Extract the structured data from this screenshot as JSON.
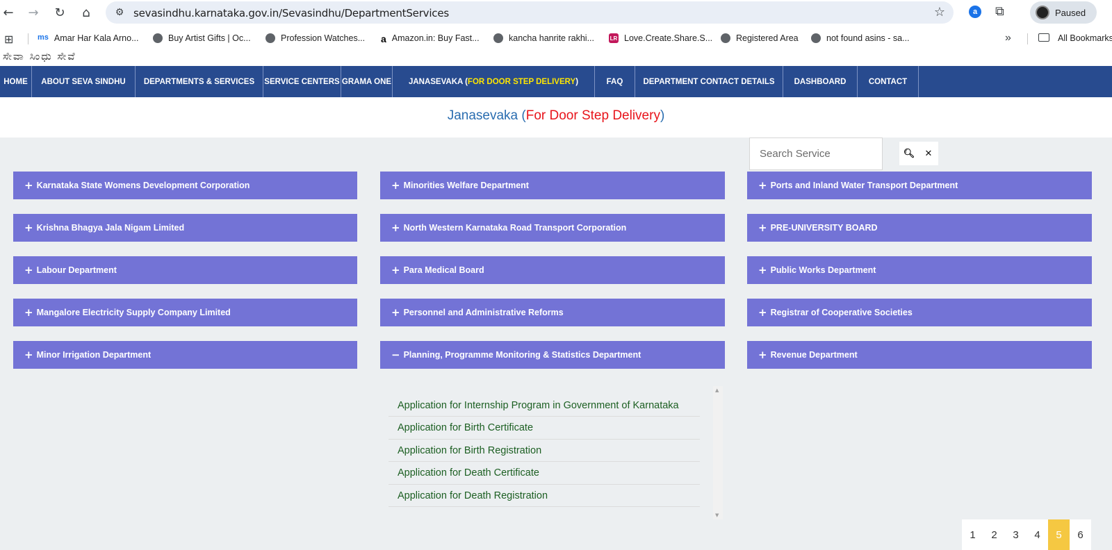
{
  "browser": {
    "url": "sevasindhu.karnataka.gov.in/Sevasindhu/DepartmentServices",
    "profile_label": "Paused",
    "ext_letter": "a",
    "bookmarks": [
      {
        "label": "Amar Har Kala Arno...",
        "icon": "ms-icon",
        "icon_text": "ms"
      },
      {
        "label": "Buy Artist Gifts | Oc...",
        "icon": "globe-icon"
      },
      {
        "label": "Profession Watches...",
        "icon": "globe-icon"
      },
      {
        "label": "Amazon.in: Buy Fast...",
        "icon": "amazon-icon",
        "icon_text": "a"
      },
      {
        "label": "kancha hanrite rakhi...",
        "icon": "globe-icon"
      },
      {
        "label": "Love.Create.Share.S...",
        "icon": "lr-icon",
        "icon_text": "LR"
      },
      {
        "label": "Registered Area",
        "icon": "globe-icon"
      },
      {
        "label": "not found asins - sa...",
        "icon": "globe-icon"
      }
    ],
    "all_bookmarks": "All Bookmarks"
  },
  "site": {
    "logo_text": "ಸೇವಾ ಸಿಂಧು ಸೇವೆ",
    "nav": [
      {
        "label": "HOME",
        "w": 46
      },
      {
        "label": "ABOUT SEVA SINDHU",
        "w": 149
      },
      {
        "label": "DEPARTMENTS & SERVICES",
        "w": 184
      },
      {
        "label": "SERVICE CENTERS",
        "w": 112
      },
      {
        "label": "GRAMA ONE",
        "w": 74
      },
      {
        "label": "JANASEVAKA (",
        "hl": "FOR DOOR STEP DELIVERY",
        "tail": ")",
        "w": 291
      },
      {
        "label": "FAQ",
        "w": 58
      },
      {
        "label": "DEPARTMENT CONTACT DETAILS",
        "w": 213
      },
      {
        "label": "DASHBOARD",
        "w": 107
      },
      {
        "label": "CONTACT",
        "w": 88
      }
    ],
    "title_main": "Janasevaka (",
    "title_red": "For Door Step Delivery",
    "title_close": ")",
    "search_placeholder": "Search Service",
    "departments": [
      [
        "Karnataka State Womens Development Corporation",
        "Minorities Welfare Department",
        "Ports and Inland Water Transport Department"
      ],
      [
        "Krishna Bhagya Jala Nigam Limited",
        "North Western Karnataka Road Transport Corporation",
        "PRE-UNIVERSITY BOARD"
      ],
      [
        "Labour Department",
        "Para Medical Board",
        "Public Works Department"
      ],
      [
        "Mangalore Electricity Supply Company Limited",
        "Personnel and Administrative Reforms",
        "Registrar of Cooperative Societies"
      ],
      [
        "Minor Irrigation Department",
        "Planning, Programme Monitoring & Statistics Department",
        "Revenue Department"
      ]
    ],
    "expanded": {
      "row": 4,
      "col": 1
    },
    "services": [
      "Application for Internship Program in Government of Karnataka",
      "Application for Birth Certificate",
      "Application for Birth Registration",
      "Application for Death Certificate",
      "Application for Death Registration"
    ],
    "pages": [
      "1",
      "2",
      "3",
      "4",
      "5",
      "6"
    ],
    "active_page": "5"
  }
}
